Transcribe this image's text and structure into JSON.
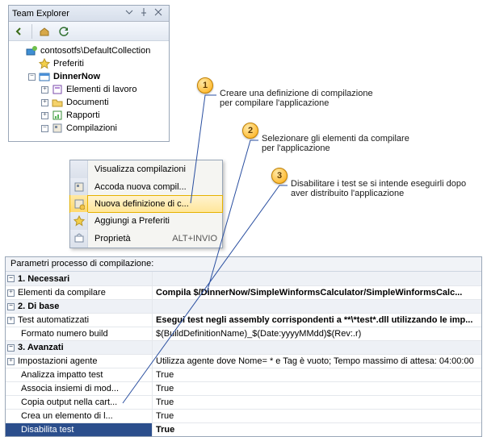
{
  "team_explorer": {
    "title": "Team Explorer",
    "root": "contosotfs\\DefaultCollection",
    "fav": "Preferiti",
    "project": "DinnerNow",
    "nodes": {
      "workitems": "Elementi di lavoro",
      "documents": "Documenti",
      "reports": "Rapporti",
      "builds": "Compilazioni"
    }
  },
  "context_menu": {
    "view_builds": "Visualizza compilazioni",
    "queue_new": "Accoda nuova compil...",
    "new_def": "Nuova definizione di c...",
    "add_fav": "Aggiungi a Preferiti",
    "properties": "Proprietà",
    "properties_shortcut": "ALT+INVIO"
  },
  "callouts": {
    "c1": {
      "num": "1",
      "l1": "Creare una definizione di compilazione",
      "l2": "per compilare l'applicazione"
    },
    "c2": {
      "num": "2",
      "l1": "Selezionare gli elementi da compilare",
      "l2": "per l'applicazione"
    },
    "c3": {
      "num": "3",
      "l1": "Disabilitare i test se si intende eseguirli dopo",
      "l2": "aver distribuito l'applicazione"
    }
  },
  "propgrid": {
    "title": "Parametri processo di compilazione:",
    "cat1": "1. Necessari",
    "items_to_build": {
      "name": "Elementi da compilare",
      "value": "Compila $/DinnerNow/SimpleWinformsCalculator/SimpleWinformsCalc..."
    },
    "cat2": "2. Di base",
    "auto_tests": {
      "name": "Test automatizzati",
      "value": "Esegui test negli assembly corrispondenti a **\\*test*.dll utilizzando le imp..."
    },
    "build_num": {
      "name": "Formato numero build",
      "value": "$(BuildDefinitionName)_$(Date:yyyyMMdd)$(Rev:.r)"
    },
    "cat3": "3. Avanzati",
    "agent": {
      "name": "Impostazioni agente",
      "value": "Utilizza agente dove Nome= * e Tag è vuoto; Tempo massimo di attesa: 04:00:00"
    },
    "analyze": {
      "name": "Analizza impatto test",
      "value": "True"
    },
    "assoc": {
      "name": "Associa insiemi di mod...",
      "value": "True"
    },
    "copy": {
      "name": "Copia output nella cart...",
      "value": "True"
    },
    "create": {
      "name": "Crea un elemento di l...",
      "value": "True"
    },
    "disable": {
      "name": "Disabilita test",
      "value": "True"
    }
  }
}
